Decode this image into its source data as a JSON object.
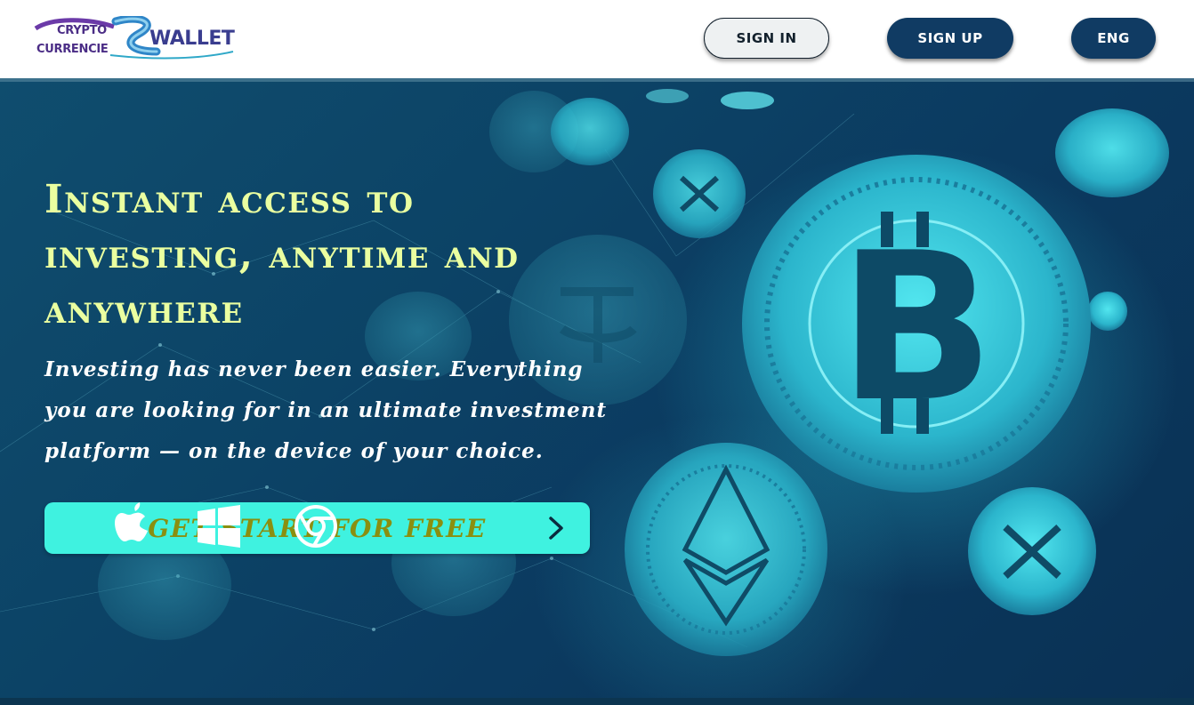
{
  "header": {
    "logo": {
      "line1": "CRYPTO",
      "line2": "CURRENCIE",
      "brand": "WALLET"
    },
    "sign_in": "SIGN IN",
    "sign_up": "SIGN UP",
    "language": "ENG"
  },
  "hero": {
    "headline": "Instant access to investing, anytime and anywhere",
    "subtext": "Investing has never been easier. Everything you are looking for in an ultimate investment platform — on the device of your choice.",
    "cta_label": "GET START FOR FREE",
    "platforms": [
      "apple-icon",
      "windows-icon",
      "chrome-icon"
    ]
  },
  "colors": {
    "headline": "#eaffa0",
    "cta_bg": "#3ff2e0",
    "cta_text": "#8a8f10",
    "button_dark": "#103b63",
    "hero_bg": "#0c4366"
  }
}
